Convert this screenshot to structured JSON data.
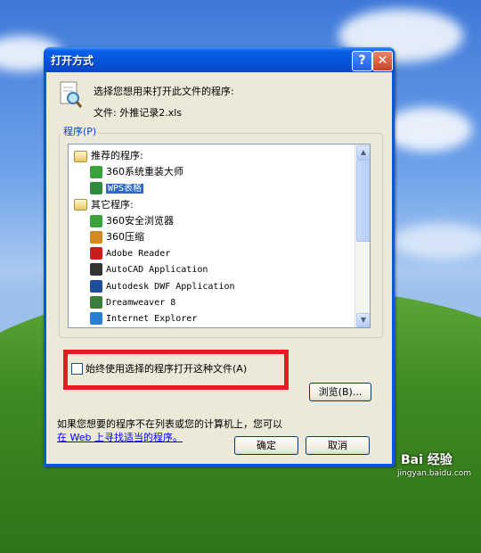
{
  "dialog": {
    "title": "打开方式",
    "help_btn": "?",
    "close_btn": "✕",
    "prompt": "选择您想用来打开此文件的程序:",
    "filename": "文件: 外推记录2.xls",
    "group_label": "程序(P)",
    "program_list": [
      {
        "kind": "category",
        "label": "推荐的程序:",
        "icon": "folder-icon"
      },
      {
        "kind": "program",
        "label": "360系统重装大师",
        "icon": "360-reinstall-icon",
        "color": "#3aa23a"
      },
      {
        "kind": "program",
        "label": "WPS表格",
        "icon": "wps-sheet-icon",
        "color": "#2e8b3e",
        "selected": true
      },
      {
        "kind": "category",
        "label": "其它程序:",
        "icon": "folder-icon"
      },
      {
        "kind": "program",
        "label": "360安全浏览器",
        "icon": "360-browser-icon",
        "color": "#3aa23a"
      },
      {
        "kind": "program",
        "label": "360压缩",
        "icon": "360-zip-icon",
        "color": "#d08a20"
      },
      {
        "kind": "program",
        "label": "Adobe Reader",
        "icon": "adobe-reader-icon",
        "color": "#c81e1e"
      },
      {
        "kind": "program",
        "label": "AutoCAD Application",
        "icon": "autocad-icon",
        "color": "#333333"
      },
      {
        "kind": "program",
        "label": "Autodesk DWF Application",
        "icon": "autodesk-dwf-icon",
        "color": "#1f4e9c"
      },
      {
        "kind": "program",
        "label": "Dreamweaver 8",
        "icon": "dreamweaver-icon",
        "color": "#3b7d3b"
      },
      {
        "kind": "program",
        "label": "Internet Explorer",
        "icon": "internet-explorer-icon",
        "color": "#2a7fd4"
      }
    ],
    "always_use_label": "始终使用选择的程序打开这种文件(A)",
    "always_use_checked": false,
    "browse_btn": "浏览(B)...",
    "hint": "如果您想要的程序不在列表或您的计算机上，您可以",
    "web_link": "在 Web 上寻找适当的程序。",
    "ok_btn": "确定",
    "cancel_btn": "取消"
  },
  "watermark": {
    "brand": "Bai 经验",
    "url": "jingyan.baidu.com"
  },
  "colors": {
    "titlebar": "#0553d8",
    "dialog_bg": "#ece9d8",
    "selection": "#316ac5",
    "highlight_box": "#e31c23"
  }
}
